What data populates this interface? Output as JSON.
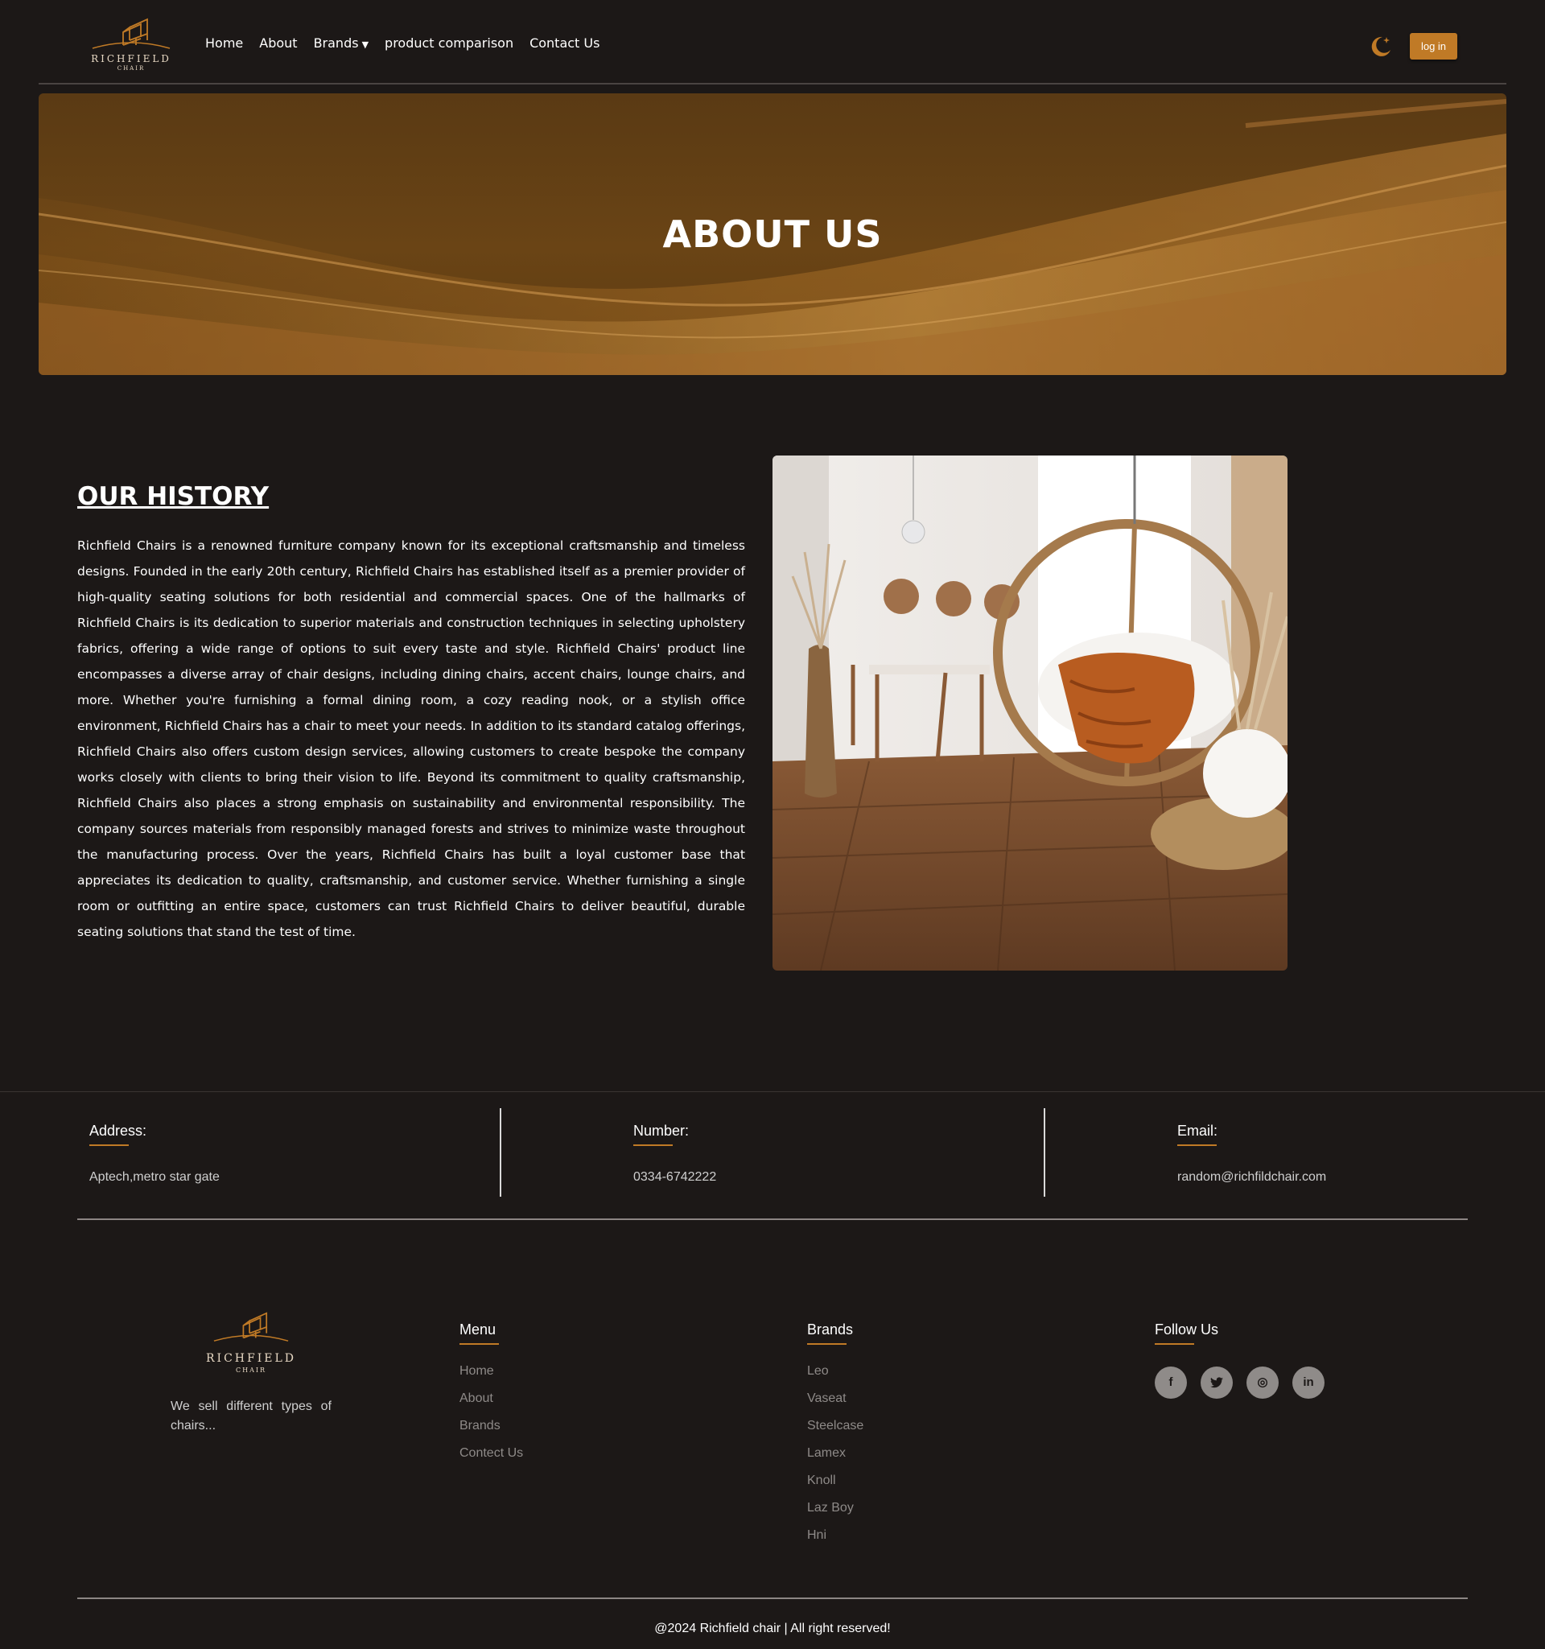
{
  "brand": {
    "name": "RICHFIELD",
    "sub": "CHAIR",
    "accent_color": "#c07a26",
    "background_color": "#1c1817"
  },
  "nav": {
    "links": [
      "Home",
      "About",
      "Brands",
      "product comparison",
      "Contact Us"
    ],
    "brands_caret": "▼",
    "theme_toggle_icon": "moon-stars-icon",
    "login_label": "log in"
  },
  "hero": {
    "title": "ABOUT US"
  },
  "history": {
    "title": "OUR HISTORY",
    "text": "Richfield Chairs is a renowned furniture company known for its exceptional craftsmanship and timeless designs. Founded in the early 20th century, Richfield Chairs has established itself as a premier provider of high-quality seating solutions for both residential and commercial spaces. One of the hallmarks of Richfield Chairs is its dedication to superior materials and construction techniques in selecting upholstery fabrics, offering a wide range of options to suit every taste and style. Richfield Chairs' product line encompasses a diverse array of chair designs, including dining chairs, accent chairs, lounge chairs, and more. Whether you're furnishing a formal dining room, a cozy reading nook, or a stylish office environment, Richfield Chairs has a chair to meet your needs. In addition to its standard catalog offerings, Richfield Chairs also offers custom design services, allowing customers to create bespoke the company works closely with clients to bring their vision to life. Beyond its commitment to quality craftsmanship, Richfield Chairs also places a strong emphasis on sustainability and environmental responsibility. The company sources materials from responsibly managed forests and strives to minimize waste throughout the manufacturing process. Over the years, Richfield Chairs has built a loyal customer base that appreciates its dedication to quality, craftsmanship, and customer service. Whether furnishing a single room or outfitting an entire space, customers can trust Richfield Chairs to deliver beautiful, durable seating solutions that stand the test of time."
  },
  "contact": {
    "address_label": "Address:",
    "address_value": "Aptech,metro star gate",
    "number_label": "Number:",
    "number_value": "0334-6742222",
    "email_label": "Email:",
    "email_value": "random@richfildchair.com"
  },
  "footer": {
    "tagline": "We sell different types of chairs...",
    "menu": {
      "title": "Menu",
      "items": [
        "Home",
        "About",
        "Brands",
        "Contect Us"
      ]
    },
    "brands": {
      "title": "Brands",
      "items": [
        "Leo",
        "Vaseat",
        "Steelcase",
        "Lamex",
        "Knoll",
        "Laz Boy",
        "Hni"
      ]
    },
    "follow": {
      "title": "Follow Us",
      "icons": [
        {
          "name": "facebook-icon",
          "glyph": "f"
        },
        {
          "name": "twitter-icon",
          "glyph": "🐦"
        },
        {
          "name": "instagram-icon",
          "glyph": "◎"
        },
        {
          "name": "linkedin-icon",
          "glyph": "in"
        }
      ]
    },
    "copyright": "@2024 Richfield chair | All right reserved!"
  }
}
